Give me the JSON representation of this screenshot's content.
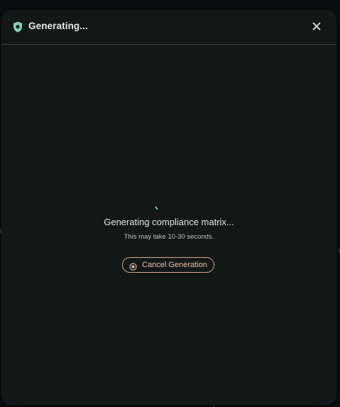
{
  "dialog": {
    "title": "Generating...",
    "title_icon": "shield-icon",
    "close_icon": "close-icon"
  },
  "status": {
    "message": "Generating compliance matrix...",
    "hint": "This may take 10-30 seconds."
  },
  "actions": {
    "cancel_label": "Cancel Generation",
    "cancel_icon": "stop-circle-icon"
  },
  "colors": {
    "accent": "#7fd3c0",
    "cancel": "#d9a58c",
    "background": "#111816"
  }
}
